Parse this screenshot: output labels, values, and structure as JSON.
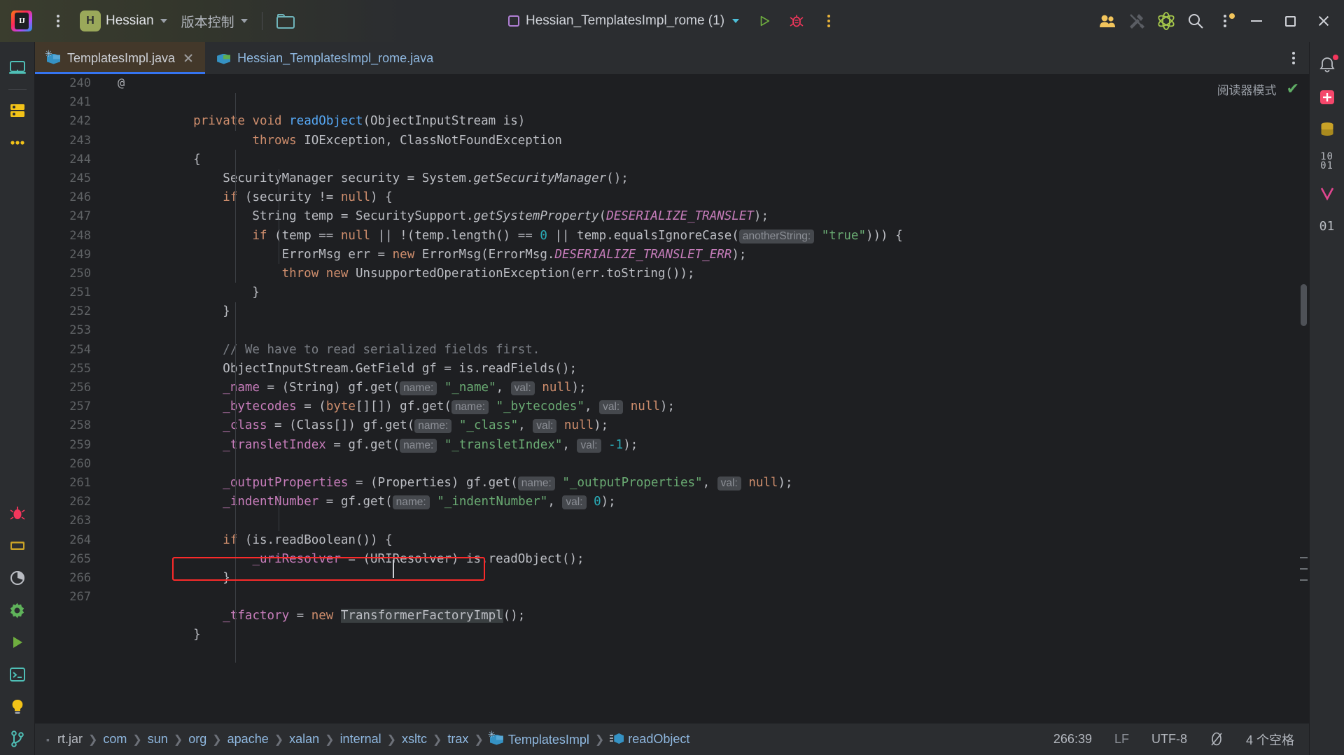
{
  "titlebar": {
    "logo_icon": "intellij-logo-icon",
    "menu_icon": "main-menu-kebab-icon",
    "project_badge": "H",
    "project_name": "Hessian",
    "vcs_label": "版本控制",
    "folder_icon": "open-folder-icon",
    "run_config": "Hessian_TemplatesImpl_rome (1)",
    "run_icon": "run-button-icon",
    "debug_icon": "debug-button-icon",
    "more_icon": "more-actions-kebab-icon",
    "collab_icon": "code-with-me-icon",
    "tools_icon": "tools-hammer-wrench-icon",
    "ai_icon": "ai-assistant-atom-icon",
    "search_icon": "search-everywhere-icon",
    "settings_icon": "settings-kebab-icon",
    "minimize_icon": "window-minimize-icon",
    "maximize_icon": "window-maximize-icon",
    "close_icon": "window-close-icon"
  },
  "left_stripe": [
    {
      "name": "project-tool-window",
      "icon": "monitor-icon"
    },
    {
      "name": "commit-tool-window",
      "icon": "database-stack-icon"
    },
    {
      "name": "more-tool-windows",
      "icon": "ellipsis-icon"
    },
    {
      "name": "bug-tool-window",
      "icon": "bug-icon"
    },
    {
      "name": "terminal-stack-icon",
      "icon": "server-icon"
    },
    {
      "name": "profiler-tool-window",
      "icon": "pie-chart-icon"
    },
    {
      "name": "settings-tool-window",
      "icon": "gear-icon"
    },
    {
      "name": "run-tool-window",
      "icon": "run-triangle-icon"
    },
    {
      "name": "terminal-tool-window",
      "icon": "terminal-icon"
    },
    {
      "name": "problems-tool-window",
      "icon": "lightbulb-icon"
    },
    {
      "name": "git-tool-window",
      "icon": "git-branch-icon"
    }
  ],
  "right_stripe": [
    {
      "name": "notifications",
      "icon": "bell-icon"
    },
    {
      "name": "ai-chat",
      "icon": "sparkle-plus-icon"
    },
    {
      "name": "database",
      "icon": "database-icon"
    },
    {
      "name": "bytecode-viewer",
      "icon": "binary-1001-icon",
      "label": "10\n01"
    },
    {
      "name": "vcs-branch",
      "icon": "v-shape-icon"
    },
    {
      "name": "binary-tool",
      "icon": "binary-01-icon",
      "label": "01"
    }
  ],
  "tabs": [
    {
      "name": "TemplatesImpl.java",
      "active": true,
      "icon": "java-class-modified-icon",
      "close_icon": "tab-close-icon"
    },
    {
      "name": "Hessian_TemplatesImpl_rome.java",
      "active": false,
      "icon": "java-class-icon"
    }
  ],
  "tabs_overflow_icon": "tab-options-kebab-icon",
  "editor": {
    "reader_mode_label": "阅读器模式",
    "inspection_status_icon": "inspections-ok-check-icon",
    "first_line": 240,
    "annotation_marker": "@",
    "lines": [
      {
        "n": 240,
        "tokens": [
          {
            "t": "    ",
            "c": "id"
          },
          {
            "t": "private ",
            "c": "kw"
          },
          {
            "t": "void ",
            "c": "kw"
          },
          {
            "t": "readObject",
            "c": "met"
          },
          {
            "t": "(ObjectInputStream is)",
            "c": "id"
          }
        ]
      },
      {
        "n": 241,
        "tokens": [
          {
            "t": "            ",
            "c": "id"
          },
          {
            "t": "throws ",
            "c": "kw"
          },
          {
            "t": "IOException, ClassNotFoundException",
            "c": "id"
          }
        ]
      },
      {
        "n": 242,
        "tokens": [
          {
            "t": "    {",
            "c": "id"
          }
        ]
      },
      {
        "n": 243,
        "tokens": [
          {
            "t": "        SecurityManager security = System.",
            "c": "id"
          },
          {
            "t": "getSecurityManager",
            "c": "sm"
          },
          {
            "t": "();",
            "c": "id"
          }
        ]
      },
      {
        "n": 244,
        "tokens": [
          {
            "t": "        ",
            "c": "id"
          },
          {
            "t": "if ",
            "c": "kw"
          },
          {
            "t": "(security != ",
            "c": "id"
          },
          {
            "t": "null",
            "c": "kw"
          },
          {
            "t": ") {",
            "c": "id"
          }
        ]
      },
      {
        "n": 245,
        "tokens": [
          {
            "t": "            String temp = SecuritySupport.",
            "c": "id"
          },
          {
            "t": "getSystemProperty",
            "c": "sm"
          },
          {
            "t": "(",
            "c": "id"
          },
          {
            "t": "DESERIALIZE_TRANSLET",
            "c": "stat"
          },
          {
            "t": ");",
            "c": "id"
          }
        ]
      },
      {
        "n": 246,
        "tokens": [
          {
            "t": "            ",
            "c": "id"
          },
          {
            "t": "if ",
            "c": "kw"
          },
          {
            "t": "(temp == ",
            "c": "id"
          },
          {
            "t": "null",
            "c": "kw"
          },
          {
            "t": " || !(temp.length() == ",
            "c": "id"
          },
          {
            "t": "0",
            "c": "num"
          },
          {
            "t": " || temp.equalsIgnoreCase(",
            "c": "id"
          },
          {
            "t": "anotherString:",
            "c": "hint"
          },
          {
            "t": " ",
            "c": "id"
          },
          {
            "t": "\"true\"",
            "c": "str"
          },
          {
            "t": "))) {",
            "c": "id"
          }
        ]
      },
      {
        "n": 247,
        "tokens": [
          {
            "t": "                ErrorMsg err = ",
            "c": "id"
          },
          {
            "t": "new ",
            "c": "kw"
          },
          {
            "t": "ErrorMsg(ErrorMsg.",
            "c": "id"
          },
          {
            "t": "DESERIALIZE_TRANSLET_ERR",
            "c": "stat"
          },
          {
            "t": ");",
            "c": "id"
          }
        ]
      },
      {
        "n": 248,
        "tokens": [
          {
            "t": "                ",
            "c": "id"
          },
          {
            "t": "throw new ",
            "c": "kw"
          },
          {
            "t": "UnsupportedOperationException(err.toString());",
            "c": "id"
          }
        ]
      },
      {
        "n": 249,
        "tokens": [
          {
            "t": "            }",
            "c": "id"
          }
        ]
      },
      {
        "n": 250,
        "tokens": [
          {
            "t": "        }",
            "c": "id"
          }
        ]
      },
      {
        "n": 251,
        "tokens": [
          {
            "t": "",
            "c": "id"
          }
        ]
      },
      {
        "n": 252,
        "tokens": [
          {
            "t": "        // We have to read serialized fields first.",
            "c": "cmt"
          }
        ]
      },
      {
        "n": 253,
        "tokens": [
          {
            "t": "        ObjectInputStream.GetField gf = is.readFields();",
            "c": "id"
          }
        ]
      },
      {
        "n": 254,
        "tokens": [
          {
            "t": "        ",
            "c": "id"
          },
          {
            "t": "_name",
            "c": "fld"
          },
          {
            "t": " = (String) gf.get(",
            "c": "id"
          },
          {
            "t": "name:",
            "c": "hint"
          },
          {
            "t": " ",
            "c": "id"
          },
          {
            "t": "\"_name\"",
            "c": "str"
          },
          {
            "t": ", ",
            "c": "id"
          },
          {
            "t": "val:",
            "c": "hint"
          },
          {
            "t": " ",
            "c": "id"
          },
          {
            "t": "null",
            "c": "kw"
          },
          {
            "t": ");",
            "c": "id"
          }
        ]
      },
      {
        "n": 255,
        "tokens": [
          {
            "t": "        ",
            "c": "id"
          },
          {
            "t": "_bytecodes",
            "c": "fld"
          },
          {
            "t": " = (",
            "c": "id"
          },
          {
            "t": "byte",
            "c": "kw"
          },
          {
            "t": "[][]) gf.get(",
            "c": "id"
          },
          {
            "t": "name:",
            "c": "hint"
          },
          {
            "t": " ",
            "c": "id"
          },
          {
            "t": "\"_bytecodes\"",
            "c": "str"
          },
          {
            "t": ", ",
            "c": "id"
          },
          {
            "t": "val:",
            "c": "hint"
          },
          {
            "t": " ",
            "c": "id"
          },
          {
            "t": "null",
            "c": "kw"
          },
          {
            "t": ");",
            "c": "id"
          }
        ]
      },
      {
        "n": 256,
        "tokens": [
          {
            "t": "        ",
            "c": "id"
          },
          {
            "t": "_class",
            "c": "fld"
          },
          {
            "t": " = (Class[]) gf.get(",
            "c": "id"
          },
          {
            "t": "name:",
            "c": "hint"
          },
          {
            "t": " ",
            "c": "id"
          },
          {
            "t": "\"_class\"",
            "c": "str"
          },
          {
            "t": ", ",
            "c": "id"
          },
          {
            "t": "val:",
            "c": "hint"
          },
          {
            "t": " ",
            "c": "id"
          },
          {
            "t": "null",
            "c": "kw"
          },
          {
            "t": ");",
            "c": "id"
          }
        ]
      },
      {
        "n": 257,
        "tokens": [
          {
            "t": "        ",
            "c": "id"
          },
          {
            "t": "_transletIndex",
            "c": "fld"
          },
          {
            "t": " = gf.get(",
            "c": "id"
          },
          {
            "t": "name:",
            "c": "hint"
          },
          {
            "t": " ",
            "c": "id"
          },
          {
            "t": "\"_transletIndex\"",
            "c": "str"
          },
          {
            "t": ", ",
            "c": "id"
          },
          {
            "t": "val:",
            "c": "hint"
          },
          {
            "t": " ",
            "c": "id"
          },
          {
            "t": "-1",
            "c": "num"
          },
          {
            "t": ");",
            "c": "id"
          }
        ]
      },
      {
        "n": 258,
        "tokens": [
          {
            "t": "",
            "c": "id"
          }
        ]
      },
      {
        "n": 259,
        "tokens": [
          {
            "t": "        ",
            "c": "id"
          },
          {
            "t": "_outputProperties",
            "c": "fld"
          },
          {
            "t": " = (Properties) gf.get(",
            "c": "id"
          },
          {
            "t": "name:",
            "c": "hint"
          },
          {
            "t": " ",
            "c": "id"
          },
          {
            "t": "\"_outputProperties\"",
            "c": "str"
          },
          {
            "t": ", ",
            "c": "id"
          },
          {
            "t": "val:",
            "c": "hint"
          },
          {
            "t": " ",
            "c": "id"
          },
          {
            "t": "null",
            "c": "kw"
          },
          {
            "t": ");",
            "c": "id"
          }
        ]
      },
      {
        "n": 260,
        "tokens": [
          {
            "t": "        ",
            "c": "id"
          },
          {
            "t": "_indentNumber",
            "c": "fld"
          },
          {
            "t": " = gf.get(",
            "c": "id"
          },
          {
            "t": "name:",
            "c": "hint"
          },
          {
            "t": " ",
            "c": "id"
          },
          {
            "t": "\"_indentNumber\"",
            "c": "str"
          },
          {
            "t": ", ",
            "c": "id"
          },
          {
            "t": "val:",
            "c": "hint"
          },
          {
            "t": " ",
            "c": "id"
          },
          {
            "t": "0",
            "c": "num"
          },
          {
            "t": ");",
            "c": "id"
          }
        ]
      },
      {
        "n": 261,
        "tokens": [
          {
            "t": "",
            "c": "id"
          }
        ]
      },
      {
        "n": 262,
        "tokens": [
          {
            "t": "        ",
            "c": "id"
          },
          {
            "t": "if ",
            "c": "kw"
          },
          {
            "t": "(is.readBoolean()) {",
            "c": "id"
          }
        ]
      },
      {
        "n": 263,
        "tokens": [
          {
            "t": "            ",
            "c": "id"
          },
          {
            "t": "_uriResolver",
            "c": "fld"
          },
          {
            "t": " = (URIResolver) is.readObject();",
            "c": "id"
          }
        ]
      },
      {
        "n": 264,
        "tokens": [
          {
            "t": "        }",
            "c": "id"
          }
        ]
      },
      {
        "n": 265,
        "tokens": [
          {
            "t": "",
            "c": "id"
          }
        ]
      },
      {
        "n": 266,
        "tokens": [
          {
            "t": "        ",
            "c": "id"
          },
          {
            "t": "_tfactory",
            "c": "fld"
          },
          {
            "t": " = ",
            "c": "id"
          },
          {
            "t": "new ",
            "c": "kw"
          },
          {
            "t": "TransformerFactoryImpl",
            "c": "id caret-hl"
          },
          {
            "t": "();",
            "c": "id"
          }
        ]
      },
      {
        "n": 267,
        "tokens": [
          {
            "t": "    }",
            "c": "id"
          }
        ]
      }
    ],
    "highlight_box_line": 266,
    "caret_line": 266,
    "caret_col_text": "TransformerFac|toryImpl"
  },
  "status_bar": {
    "breadcrumbs": [
      {
        "label": "rt.jar",
        "type": "plain"
      },
      {
        "label": "com",
        "type": "link"
      },
      {
        "label": "sun",
        "type": "link"
      },
      {
        "label": "org",
        "type": "link"
      },
      {
        "label": "apache",
        "type": "link"
      },
      {
        "label": "xalan",
        "type": "link"
      },
      {
        "label": "internal",
        "type": "link"
      },
      {
        "label": "xsltc",
        "type": "link"
      },
      {
        "label": "trax",
        "type": "link"
      },
      {
        "label": "TemplatesImpl",
        "type": "class"
      },
      {
        "label": "readObject",
        "type": "method"
      }
    ],
    "caret_position": "266:39",
    "line_separator": "LF",
    "encoding": "UTF-8",
    "readonly_icon": "read-only-lock-icon",
    "indent": "4 个空格"
  }
}
